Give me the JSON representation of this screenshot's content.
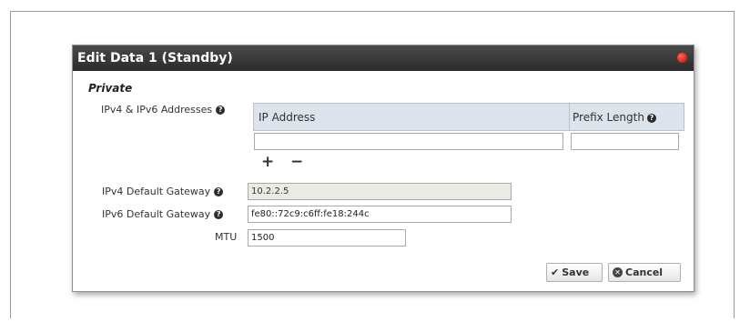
{
  "dialog": {
    "title": "Edit Data 1 (Standby)",
    "close_icon": "close-icon"
  },
  "section": {
    "title": "Private"
  },
  "addresses": {
    "label": "IPv4 & IPv6 Addresses",
    "help_icon": "question-circle-icon",
    "columns": [
      "IP Address",
      "Prefix Length"
    ],
    "row": {
      "ip_value": "",
      "prefix_value": ""
    },
    "add_icon": "plus-icon",
    "remove_icon": "minus-icon"
  },
  "ipv4_gateway": {
    "label": "IPv4 Default Gateway",
    "value": "10.2.2.5",
    "disabled": true
  },
  "ipv6_gateway": {
    "label": "IPv6 Default Gateway",
    "value": "fe80::72c9:c6ff:fe18:244c"
  },
  "mtu": {
    "label": "MTU",
    "value": "1500"
  },
  "buttons": {
    "save_label": "Save",
    "cancel_label": "Cancel"
  },
  "colors": {
    "header_bg": "#333333",
    "table_header_bg": "#dce3ea",
    "close_icon": "#d8201a"
  }
}
